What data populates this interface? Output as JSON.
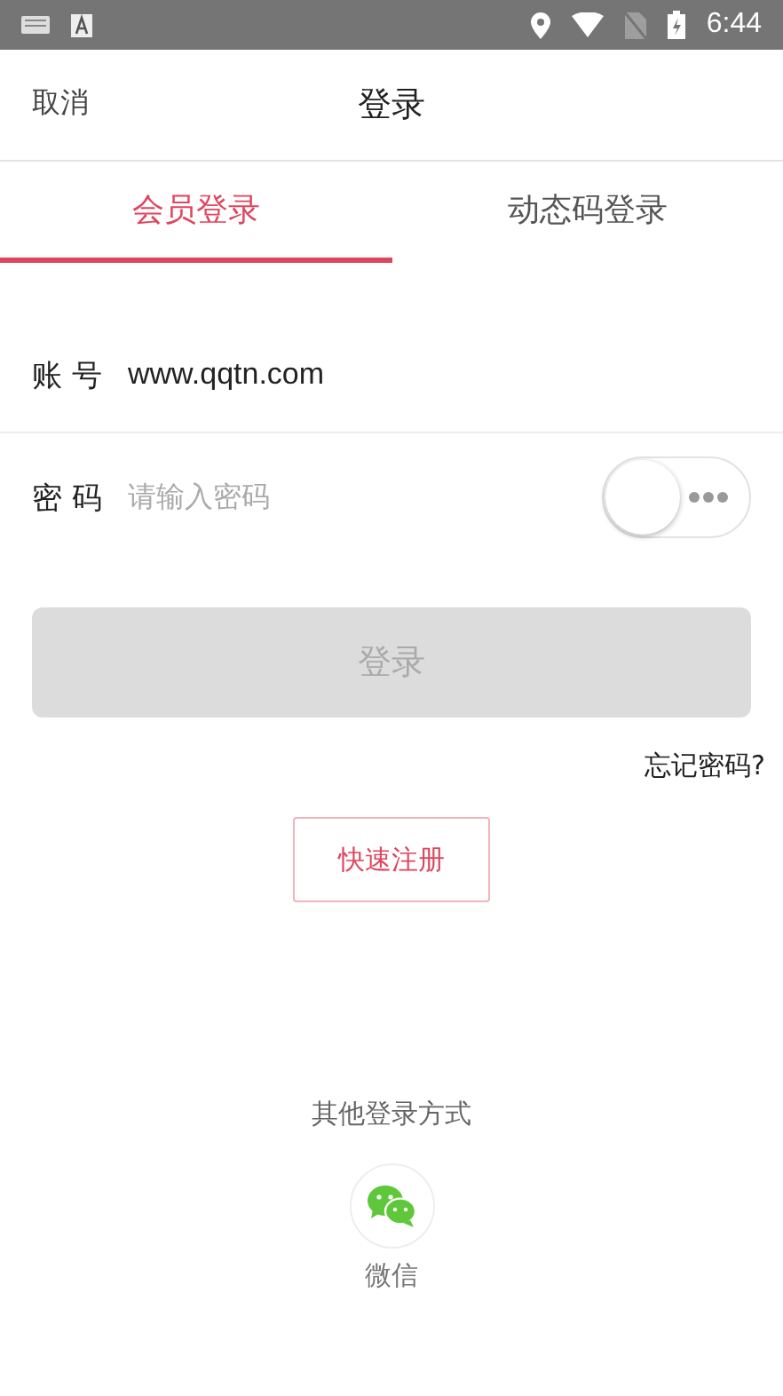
{
  "status_bar": {
    "time": "6:44"
  },
  "header": {
    "cancel": "取消",
    "title": "登录"
  },
  "tabs": [
    {
      "label": "会员登录",
      "selected": true
    },
    {
      "label": "动态码登录",
      "selected": false
    }
  ],
  "fields": [
    {
      "label": "账 号",
      "value": "www.qqtn.com"
    },
    {
      "label": "密 码",
      "placeholder": "请输入密码"
    }
  ],
  "password_visibility_toggle": {
    "on": false
  },
  "login_button": {
    "label": "登录",
    "disabled": true
  },
  "forgot_password": "忘记密码?",
  "register_button": "快速注册",
  "other_login": {
    "heading": "其他登录方式",
    "options": [
      {
        "label": "微信"
      }
    ]
  }
}
